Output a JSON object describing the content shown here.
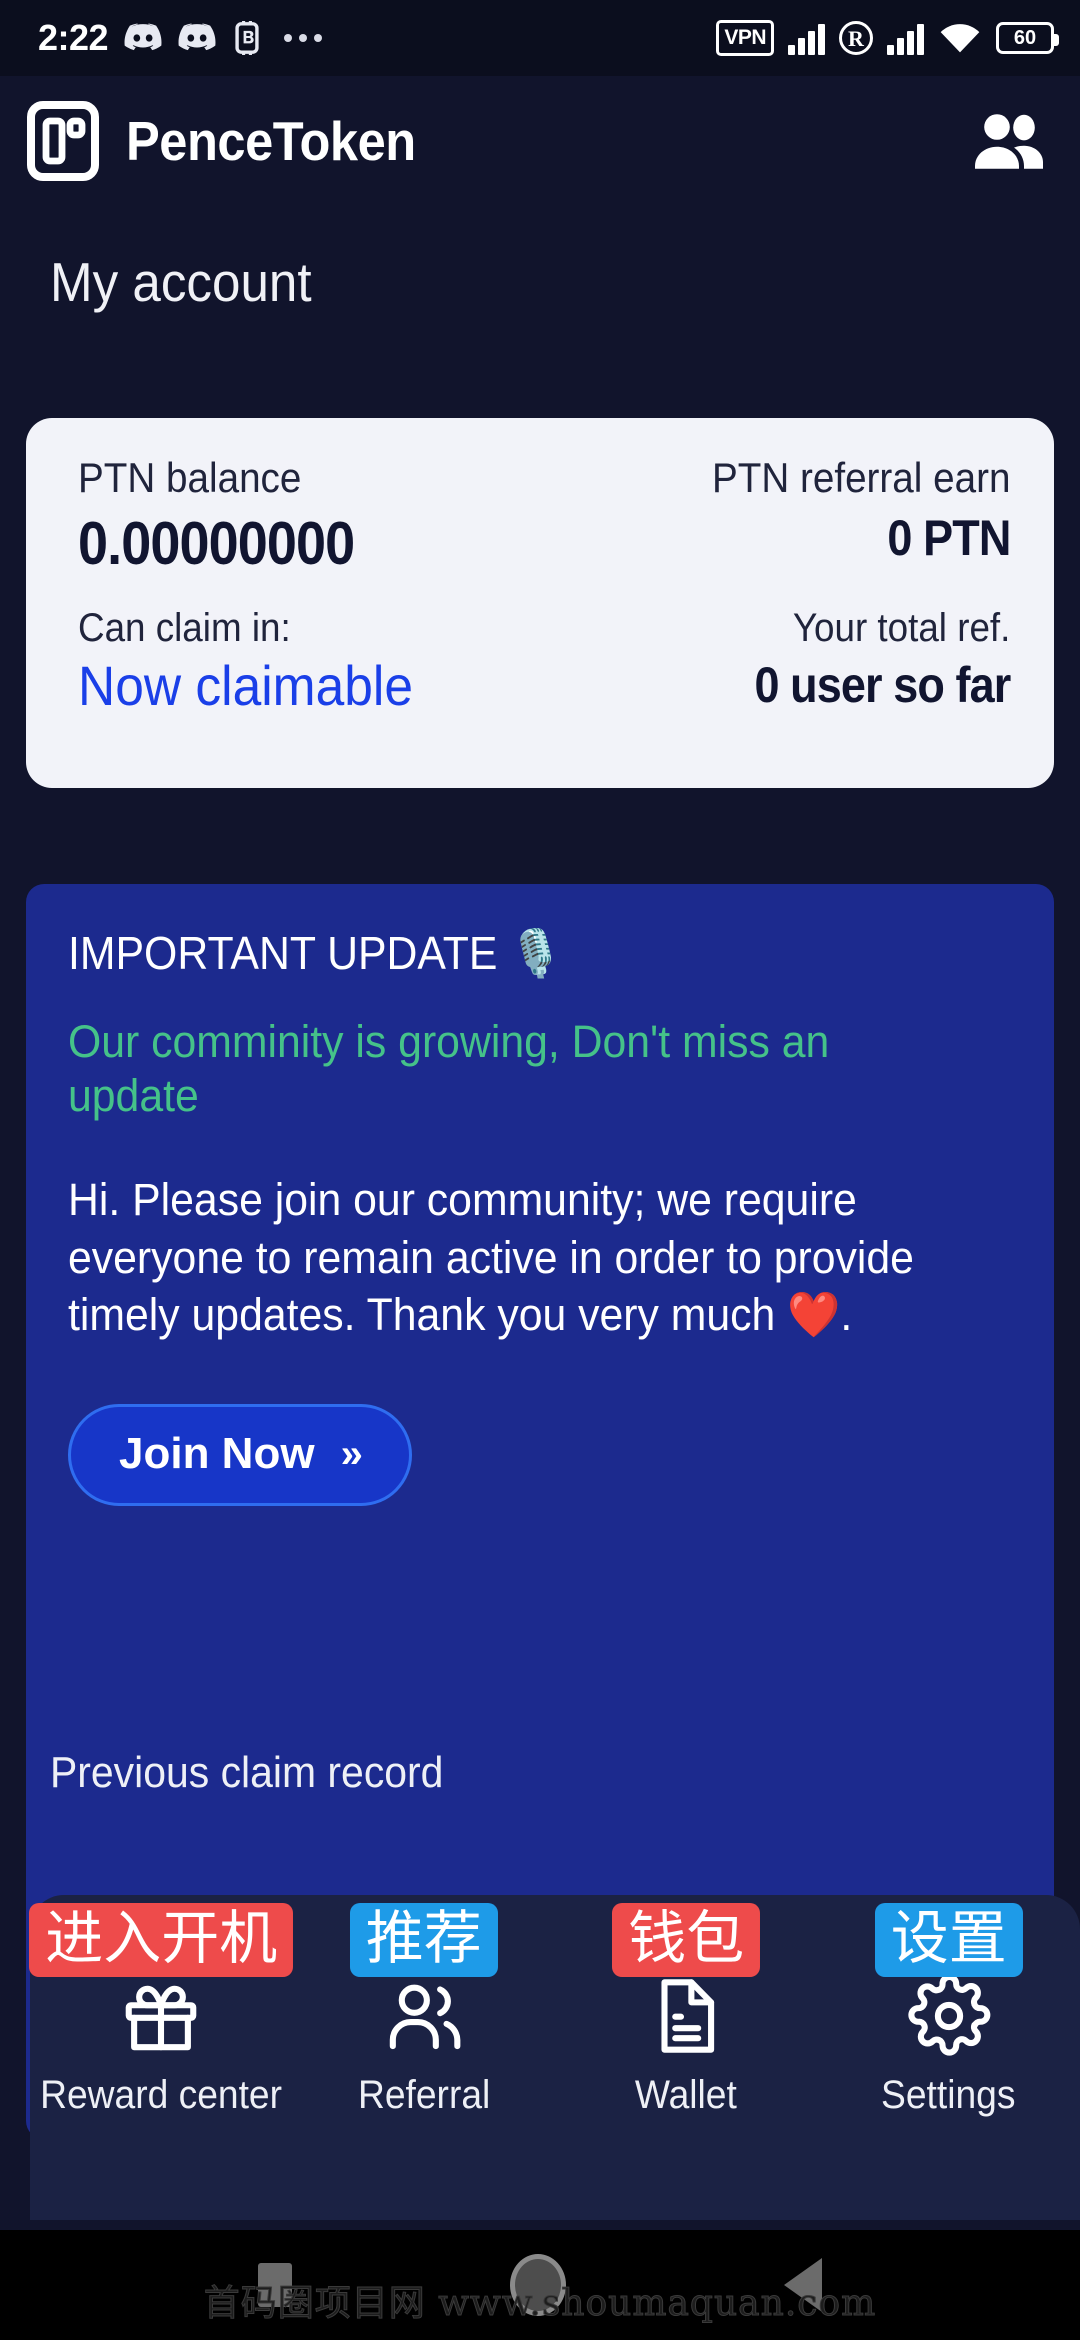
{
  "status_bar": {
    "clock": "2:22",
    "left_icons": [
      "discord-icon",
      "discord-icon",
      "bitcoin-icon",
      "more-notifications-ellipsis-icon"
    ],
    "vpn_label": "VPN",
    "roaming_label": "R",
    "battery_level": "60",
    "right_icons": [
      "vpn-badge-icon",
      "signal-bars-icon",
      "roaming-icon",
      "signal-bars-icon",
      "wifi-icon",
      "battery-icon"
    ]
  },
  "header": {
    "brand": "PenceToken",
    "logo_icon": "pencetoken-logo-icon",
    "people_icon": "people-group-icon"
  },
  "page": {
    "title": "My account"
  },
  "balance_card": {
    "balance_label": "PTN balance",
    "balance_value": "0.00000000",
    "referral_earn_label": "PTN referral earn",
    "referral_earn_value": "0 PTN",
    "claim_label": "Can claim in:",
    "claim_state": "Now claimable",
    "total_ref_label": "Your total ref.",
    "total_ref_value": "0 user so far",
    "claim_state_color": "#1a3fe8",
    "card_bg": "#f2f3f9"
  },
  "update_card": {
    "title": "IMPORTANT UPDATE 🎙️",
    "subtitle": "Our comminity is growing, Don't miss an update",
    "body": "Hi. Please join our community; we require everyone to remain active in order to provide timely updates. Thank you very much ❤️.",
    "join_label": "Join Now",
    "join_chevron": "»",
    "card_bg": "#1c2a8e",
    "subtitle_color": "#45c289"
  },
  "records": {
    "section_label": "Previous claim record"
  },
  "bottom_nav": {
    "items": [
      {
        "label": "Reward center",
        "badge": "进入开机",
        "badge_color": "red",
        "icon": "gift-icon"
      },
      {
        "label": "Referral",
        "badge": "推荐",
        "badge_color": "blue",
        "icon": "people-icon"
      },
      {
        "label": "Wallet",
        "badge": "钱包",
        "badge_color": "red",
        "icon": "document-icon"
      },
      {
        "label": "Settings",
        "badge": "设置",
        "badge_color": "blue",
        "icon": "gear-icon"
      }
    ],
    "badge_red": "#ee4b4b",
    "badge_blue": "#1e9be8",
    "panel_bg": "#1b2244"
  },
  "system_nav": {
    "recents_icon": "square-recents-icon",
    "home_icon": "circle-home-icon",
    "back_icon": "triangle-back-icon",
    "watermark": "首码圈项目网 www.shoumaquan.com"
  }
}
